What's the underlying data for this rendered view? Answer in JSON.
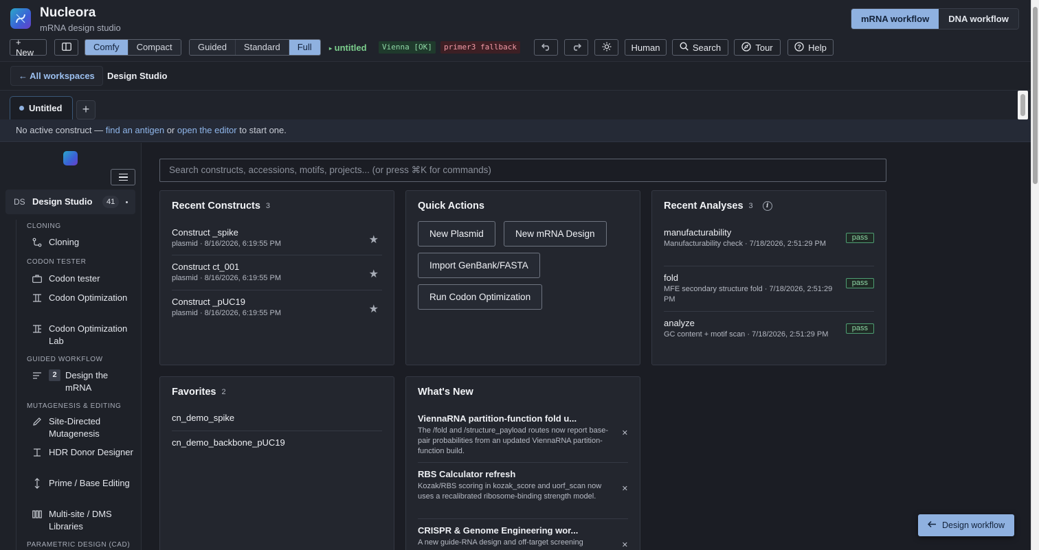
{
  "header": {
    "app_name": "Nucleora",
    "app_subtitle": "mRNA design studio",
    "workflow_tabs": [
      "mRNA workflow",
      "DNA workflow"
    ],
    "new_label": "+ New",
    "density_options": [
      "Comfy",
      "Compact"
    ],
    "mode_options": [
      "Guided",
      "Standard",
      "Full"
    ],
    "project_name": "untitled",
    "vienna_status": "Vienna [OK]",
    "primer_status": "primer3 fallback",
    "human_label": "Human",
    "search_label": "Search",
    "tour_label": "Tour",
    "help_label": "Help"
  },
  "breadcrumb": {
    "back_label": "← All workspaces",
    "current": "Design Studio"
  },
  "tabs": {
    "active_tab": "Untitled",
    "add_label": "+"
  },
  "notice": {
    "prefix": "No active construct — ",
    "link1": "find an antigen",
    "middle": " or ",
    "link2": "open the editor",
    "suffix": " to start one."
  },
  "sidebar": {
    "workspace_code": "DS",
    "workspace_name": "Design Studio",
    "workspace_count": "41",
    "sections": {
      "cloning": "CLONING",
      "codon_tester": "CODON TESTER",
      "guided": "GUIDED WORKFLOW",
      "mutagenesis": "MUTAGENESIS & EDITING",
      "parametric": "PARAMETRIC DESIGN (CAD)"
    },
    "items": {
      "cloning": "Cloning",
      "codon_tester": "Codon tester",
      "codon_opt": "Codon Optimization",
      "codon_lab": "Codon Optimization Lab",
      "design_mrna_step": "2",
      "design_mrna": "Design the mRNA",
      "site_directed": "Site-Directed Mutagenesis",
      "hdr": "HDR Donor Designer",
      "prime": "Prime / Base Editing",
      "multisite": "Multi-site / DMS Libraries"
    }
  },
  "search": {
    "placeholder": "Search constructs, accessions, motifs, projects... (or press ⌘K for commands)"
  },
  "recent_constructs": {
    "title": "Recent Constructs",
    "count": "3",
    "items": [
      {
        "name": "Construct _spike",
        "meta": "plasmid · 8/16/2026, 6:19:55 PM"
      },
      {
        "name": "Construct ct_001",
        "meta": "plasmid · 8/16/2026, 6:19:55 PM"
      },
      {
        "name": "Construct _pUC19",
        "meta": "plasmid · 8/16/2026, 6:19:55 PM"
      }
    ]
  },
  "quick_actions": {
    "title": "Quick Actions",
    "buttons": [
      "New Plasmid",
      "New mRNA Design",
      "Import GenBank/FASTA",
      "Run Codon Optimization"
    ]
  },
  "recent_analyses": {
    "title": "Recent Analyses",
    "count": "3",
    "items": [
      {
        "name": "manufacturability",
        "meta": "Manufacturability check · 7/18/2026, 2:51:29 PM",
        "status": "pass"
      },
      {
        "name": "fold",
        "meta": "MFE secondary structure fold · 7/18/2026, 2:51:29 PM",
        "status": "pass"
      },
      {
        "name": "analyze",
        "meta": "GC content + motif scan · 7/18/2026, 2:51:29 PM",
        "status": "pass"
      }
    ]
  },
  "favorites": {
    "title": "Favorites",
    "count": "2",
    "items": [
      "cn_demo_spike",
      "cn_demo_backbone_pUC19"
    ]
  },
  "whats_new": {
    "title": "What's New",
    "items": [
      {
        "title": "ViennaRNA partition-function fold u...",
        "body": "The /fold and /structure_payload routes now report base-pair probabilities from an updated ViennaRNA partition-function build."
      },
      {
        "title": "RBS Calculator refresh",
        "body": "Kozak/RBS scoring in kozak_score and uorf_scan now uses a recalibrated ribosome-binding strength model."
      },
      {
        "title": "CRISPR & Genome Engineering wor...",
        "body": "A new guide-RNA design and off-target screening"
      }
    ]
  },
  "float_button": {
    "label": "Design workflow"
  },
  "colors": {
    "accent": "#8fb1e0",
    "success": "#8fd8a6",
    "danger": "#f29aa6"
  }
}
